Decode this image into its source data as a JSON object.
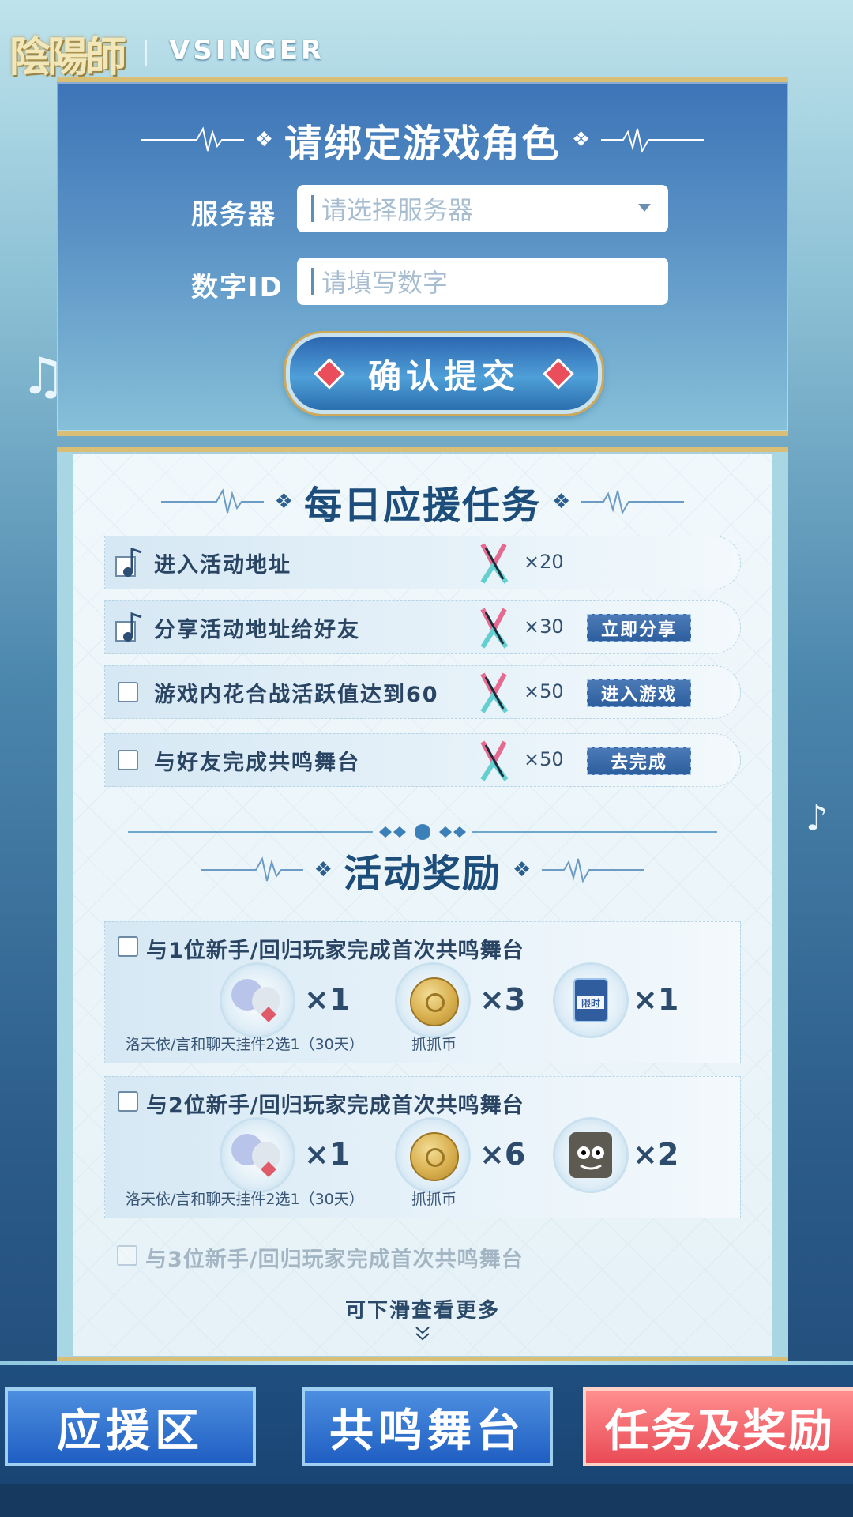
{
  "header": {
    "logo_left": "陰陽師",
    "logo_right": "VSINGER"
  },
  "bind": {
    "title": "请绑定游戏角色",
    "server_label": "服务器",
    "server_placeholder": "请选择服务器",
    "id_label": "数字ID",
    "id_placeholder": "请填写数字",
    "confirm_label": "确认提交"
  },
  "tasks": {
    "title": "每日应援任务",
    "items": [
      {
        "name": "进入活动地址",
        "count": "×20",
        "done": true,
        "button": ""
      },
      {
        "name": "分享活动地址给好友",
        "count": "×30",
        "done": true,
        "button": "立即分享"
      },
      {
        "name": "游戏内花合战活跃值达到60",
        "count": "×50",
        "done": false,
        "button": "进入游戏"
      },
      {
        "name": "与好友完成共鸣舞台",
        "count": "×50",
        "done": false,
        "button": "去完成"
      }
    ]
  },
  "rewards": {
    "title": "活动奖励",
    "items": [
      {
        "condition": "与1位新手/回归玩家完成首次共鸣舞台",
        "qty1": "×1",
        "qty2": "×3",
        "qty3": "×1",
        "label1": "洛天依/言和聊天挂件2选1（30天）",
        "label2": "抓抓币",
        "item3_text": "限时"
      },
      {
        "condition": "与2位新手/回归玩家完成首次共鸣舞台",
        "qty1": "×1",
        "qty2": "×6",
        "qty3": "×2",
        "label1": "洛天依/言和聊天挂件2选1（30天）",
        "label2": "抓抓币"
      },
      {
        "condition": "与3位新手/回归玩家完成首次共鸣舞台"
      }
    ],
    "scroll_hint": "可下滑查看更多"
  },
  "nav": {
    "tab1": "应援区",
    "tab2": "共鸣舞台",
    "tab3": "任务及奖励",
    "active": "任务及奖励"
  },
  "colors": {
    "panel_gold": "#d9bf76",
    "title_blue": "#1d4d7a",
    "button_blue": "#2e5f9e",
    "active_tab": "#e94a55"
  }
}
